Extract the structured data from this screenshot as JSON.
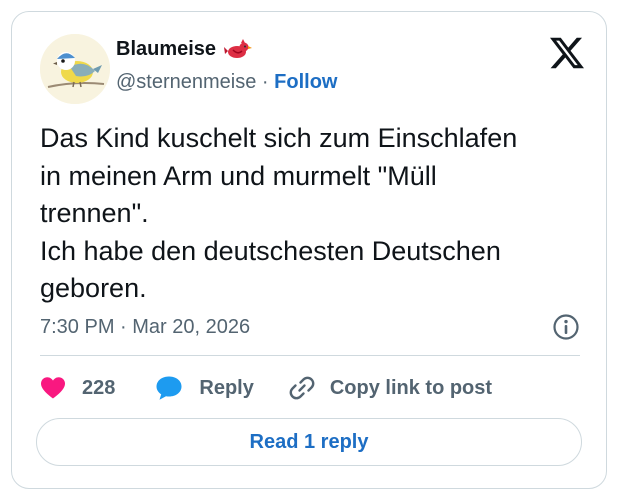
{
  "author": {
    "display_name": "Blaumeise",
    "handle": "@sternenmeise",
    "separator": " · ",
    "follow_label": "Follow",
    "badge_icon": "red-bird-icon",
    "avatar_icon": "blue-tit-bird-icon"
  },
  "brand": {
    "logo_icon": "x-logo-icon"
  },
  "tweet": {
    "text": "Das Kind kuschelt sich zum Einschlafen\nin meinen Arm und murmelt \"Müll\ntrennen\".\nIch habe den deutschesten Deutschen\ngeboren.",
    "timestamp": "7:30 PM · Mar 20, 2026"
  },
  "actions": {
    "like_count": "228",
    "reply_label": "Reply",
    "copy_label": "Copy link to post"
  },
  "footer": {
    "read_replies_label": "Read 1 reply"
  },
  "colors": {
    "accent": "#1d6ec4",
    "like": "#f91880",
    "reply_icon": "#1d9bf0",
    "text": "#0f1419",
    "muted": "#536471",
    "border": "#cfd9de"
  }
}
